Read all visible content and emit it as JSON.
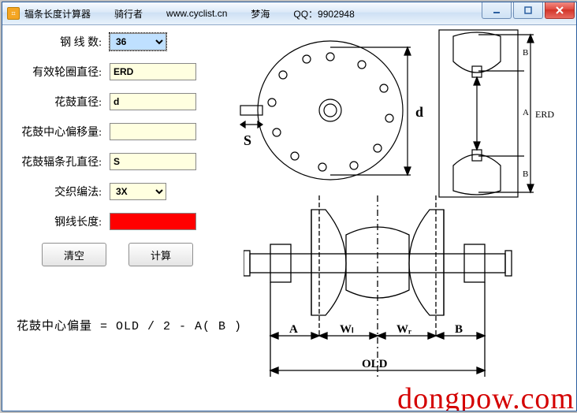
{
  "title_segments": {
    "app": "辐条长度计算器",
    "rider": "骑行者",
    "url": "www.cyclist.cn",
    "alias": "梦海",
    "qq": "QQ：9902948"
  },
  "labels": {
    "spoke_count": "钢 线 数:",
    "erd": "有效轮圈直径:",
    "hub_dia": "花鼓直径:",
    "offset": "花鼓中心偏移量:",
    "hole_dia": "花鼓辐条孔直径:",
    "cross": "交织编法:",
    "length": "钢线长度:"
  },
  "inputs": {
    "spoke_count": "36",
    "erd": "ERD",
    "hub_dia": "d",
    "offset": "",
    "hole_dia": "S",
    "cross": "3X"
  },
  "buttons": {
    "clear": "清空",
    "calc": "计算"
  },
  "formula": "花鼓中心偏量 = OLD / 2 - A( B )",
  "diagram": {
    "S": "S",
    "d": "d",
    "B": "B",
    "A": "A",
    "ERD": "ERD",
    "WL": "Wₗ",
    "WR": "Wᵣ",
    "OLD": "OLD"
  },
  "watermark": "dongpow.com"
}
